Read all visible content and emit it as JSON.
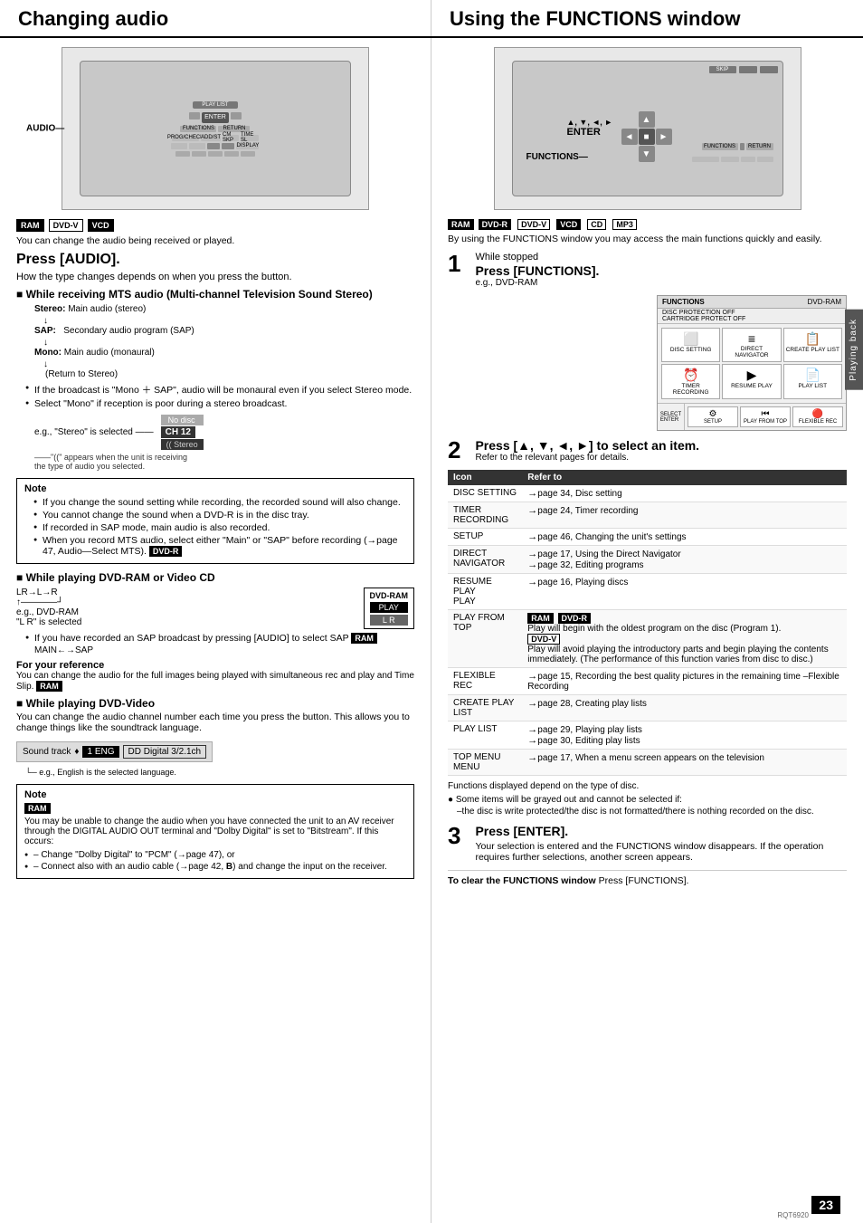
{
  "header": {
    "left_title": "Changing audio",
    "right_title": "Using the FUNCTIONS window"
  },
  "left_col": {
    "badges_top": [
      "RAM",
      "DVD-V",
      "VCD"
    ],
    "intro_text": "You can change the audio being received or played.",
    "press_audio_title": "Press [AUDIO].",
    "press_audio_sub": "How the type changes depends on when you press the button.",
    "mts_heading": "■ While receiving MTS audio (Multi-channel Television Sound Stereo)",
    "stereo_label": "Stereo:",
    "stereo_desc": "Main audio (stereo)",
    "sap_label": "SAP:",
    "sap_desc": "Secondary audio program (SAP)",
    "mono_label": "Mono:",
    "mono_desc": "Main audio (monaural)",
    "return_stereo": "(Return to Stereo)",
    "mono_sap_note": "● If the broadcast is \"Mono ＋ SAP\", audio will be monaural even if you select Stereo mode.",
    "select_mono_note": "● Select \"Mono\" if reception is poor during a stereo broadcast.",
    "stereo_selected": "e.g., \"Stereo\" is selected",
    "no_disc_label": "No disc",
    "ch12_label": "CH 12",
    "stereo_label2": "(( Stereo",
    "cc_appears": "\"((\" appears when the unit is receiving the type of audio you selected.",
    "note_title": "Note",
    "note_bullets": [
      "If you change the sound setting while recording, the recorded sound will also change.",
      "You cannot change the sound when a DVD-R is in the disc tray.",
      "If recorded in SAP mode, main audio is also recorded.",
      "When you record MTS audio, select either \"Main\" or \"SAP\" before recording (→page 47, Audio—Select MTS). DVD-R"
    ],
    "dvd_ram_heading": "■ While playing DVD-RAM or Video CD",
    "dvd_ram_label": "DVD-RAM",
    "play_label": "PLAY",
    "lr_label": "L R",
    "lr_flow": "LR→L→R",
    "lr_arrow": "↑————┘",
    "eg_dvd_ram": "e.g., DVD-RAM",
    "lr_selected": "\"L R\" is selected",
    "sap_note2": "● If you have recorded an SAP broadcast by pressing [AUDIO] to select SAP RAM",
    "main_sap": "MAIN←→SAP",
    "for_ref_title": "For your reference",
    "for_ref_text": "You can change the audio for the full images being played with simultaneous rec and play and Time Slip. RAM",
    "dvd_video_heading": "■ While playing DVD-Video",
    "dvd_video_text": "You can change the audio channel number each time you press the button. This allows you to change things like the soundtrack language.",
    "sound_track_label": "Sound track",
    "sound_track_arrow": "♦ 1 ENG",
    "sound_track_dd": "DD Digital 3/2.1ch",
    "sound_track_note": "└─ e.g., English is the selected language.",
    "note2_title": "Note",
    "note2_ram_label": "RAM",
    "note2_text": "You may be unable to change the audio when you have connected the unit to an AV receiver through the DIGITAL AUDIO OUT terminal and \"Dolby Digital\" is set to \"Bitstream\". If this occurs:",
    "note2_bullets": [
      "– Change \"Dolby Digital\" to \"PCM\" (→page 47), or",
      "– Connect also with an audio cable (→page 42, B) and change the input on the receiver."
    ]
  },
  "right_col": {
    "badges_top": [
      "RAM",
      "DVD-R",
      "DVD-V",
      "VCD",
      "CD",
      "MP3"
    ],
    "intro_text": "By using the FUNCTIONS window you may access the main functions quickly and easily.",
    "step1_number": "1",
    "step1_while": "While stopped",
    "step1_title": "Press [FUNCTIONS].",
    "step1_sub": "e.g., DVD-RAM",
    "func_window_items": [
      {
        "label": "DISC SETTING",
        "icon": "⬜"
      },
      {
        "label": "DIRECT NAVIGATOR",
        "icon": "≡"
      },
      {
        "label": "CREATE PLAY LIST",
        "icon": "📋"
      },
      {
        "label": "TIMER RECORDING",
        "icon": "⏰"
      },
      {
        "label": "RESUME PLAY",
        "icon": "▶"
      },
      {
        "label": "PLAY LIST",
        "icon": "📄"
      },
      {
        "label": "SETUP",
        "icon": "⚙"
      },
      {
        "label": "PLAY FROM TOP",
        "icon": "⏮"
      },
      {
        "label": "FLEXIBLE REC",
        "icon": "🔴"
      }
    ],
    "func_header_labels": [
      "DVD-RAM",
      "DISC PROTECTION OFF",
      "CARTRIDGE PROTECT OFF"
    ],
    "step2_number": "2",
    "step2_title": "Press [▲, ▼, ◄, ►] to select an item.",
    "step2_sub": "Refer to the relevant pages for details.",
    "table_headers": [
      "Icon",
      "Refer to"
    ],
    "table_rows": [
      {
        "icon": "DISC SETTING",
        "refer": "→page 34, Disc setting"
      },
      {
        "icon": "TIMER RECORDING",
        "refer": "→page 24, Timer recording"
      },
      {
        "icon": "SETUP",
        "refer": "→page 46, Changing the unit's settings"
      },
      {
        "icon": "DIRECT NAVIGATOR",
        "refer": "→page 17, Using the Direct Navigator\n→page 32, Editing programs"
      },
      {
        "icon": "RESUME PLAY PLAY",
        "refer": "→page 16, Playing discs"
      },
      {
        "icon": "PLAY FROM TOP",
        "refer": "RAM DVD-R\nPlay will begin with the oldest program on the disc (Program 1).\nDVD-V\nPlay will avoid playing the introductory parts and begin playing the contents immediately. (The performance of this function varies from disc to disc.)"
      },
      {
        "icon": "FLEXIBLE REC",
        "refer": "→page 15, Recording the best quality pictures in the remaining time –Flexible Recording"
      },
      {
        "icon": "CREATE PLAY LIST",
        "refer": "→page 28, Creating play lists"
      },
      {
        "icon": "PLAY LIST",
        "refer": "→page 29, Playing play lists\n→page 30, Editing play lists"
      },
      {
        "icon": "TOP MENU MENU",
        "refer": "→page 17, When a menu screen appears on the television"
      }
    ],
    "table_note1": "Functions displayed depend on the type of disc.",
    "table_note2": "● Some items will be grayed out and cannot be selected if:",
    "table_note3": "–the disc is write protected/the disc is not formatted/there is nothing recorded on the disc.",
    "step3_number": "3",
    "step3_title": "Press [ENTER].",
    "step3_text": "Your selection is entered and the FUNCTIONS window disappears. If the operation requires further selections, another screen appears.",
    "clear_title": "To clear the FUNCTIONS window",
    "clear_text": "Press [FUNCTIONS].",
    "page_number": "23",
    "rqt_label": "RQT6920",
    "playing_back_label": "Playing back",
    "enter_label": "ENTER",
    "functions_label": "FUNCTIONS",
    "arrows_label": "▲, ▼, ◄, ►"
  }
}
